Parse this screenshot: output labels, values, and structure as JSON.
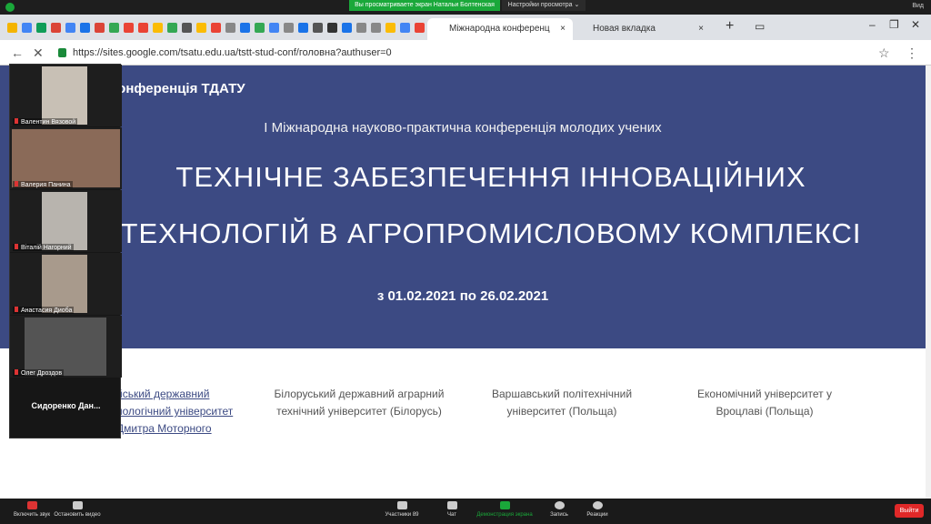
{
  "zoom_top": {
    "share_notice": "Вы просматриваете экран Натальи Болтенская",
    "view_options": "Настройки просмотра ⌄",
    "view_label": "Вид"
  },
  "browser": {
    "active_tab": "Міжнародна конференц",
    "new_tab": "Новая вкладка",
    "url": "https://sites.google.com/tsatu.edu.ua/tstt-stud-conf/головна?authuser=0"
  },
  "page": {
    "site_title": "Конференція ТДАТУ",
    "subtitle": "І Міжнародна науково-практична конференція молодих учених",
    "headline": "ТЕХНІЧНЕ ЗАБЕЗПЕЧЕННЯ ІННОВАЦІЙНИХ ТЕХНОЛОГІЙ В АГРОПРОМИСЛОВОМУ КОМПЛЕКСІ",
    "dates_prefix": "з",
    "date_from": "01.02.2021",
    "dates_mid": "по",
    "date_to": "26.02.2021",
    "partners": [
      "йський державний нологічний університет Дмитра Моторного",
      "Білоруський державний аграрний технічний університет (Білорусь)",
      "Варшавський політехнічний університет (Польща)",
      "Економічний університет у Вроцлаві (Польща)"
    ]
  },
  "participants": [
    {
      "name": "Валентин Вязовой"
    },
    {
      "name": "Валерия Панина"
    },
    {
      "name": "Віталій Нагорний"
    },
    {
      "name": "Анастасия Диоба"
    },
    {
      "name": "Олег Дроздов"
    }
  ],
  "name_card": "Сидоренко Дан...",
  "toolbar": {
    "audio": "Включить звук",
    "video": "Остановить видео",
    "participants": "Участники",
    "participants_count": "89",
    "chat": "Чат",
    "share": "Демонстрация экрана",
    "record": "Запись",
    "reactions": "Реакции",
    "leave": "Выйти"
  }
}
